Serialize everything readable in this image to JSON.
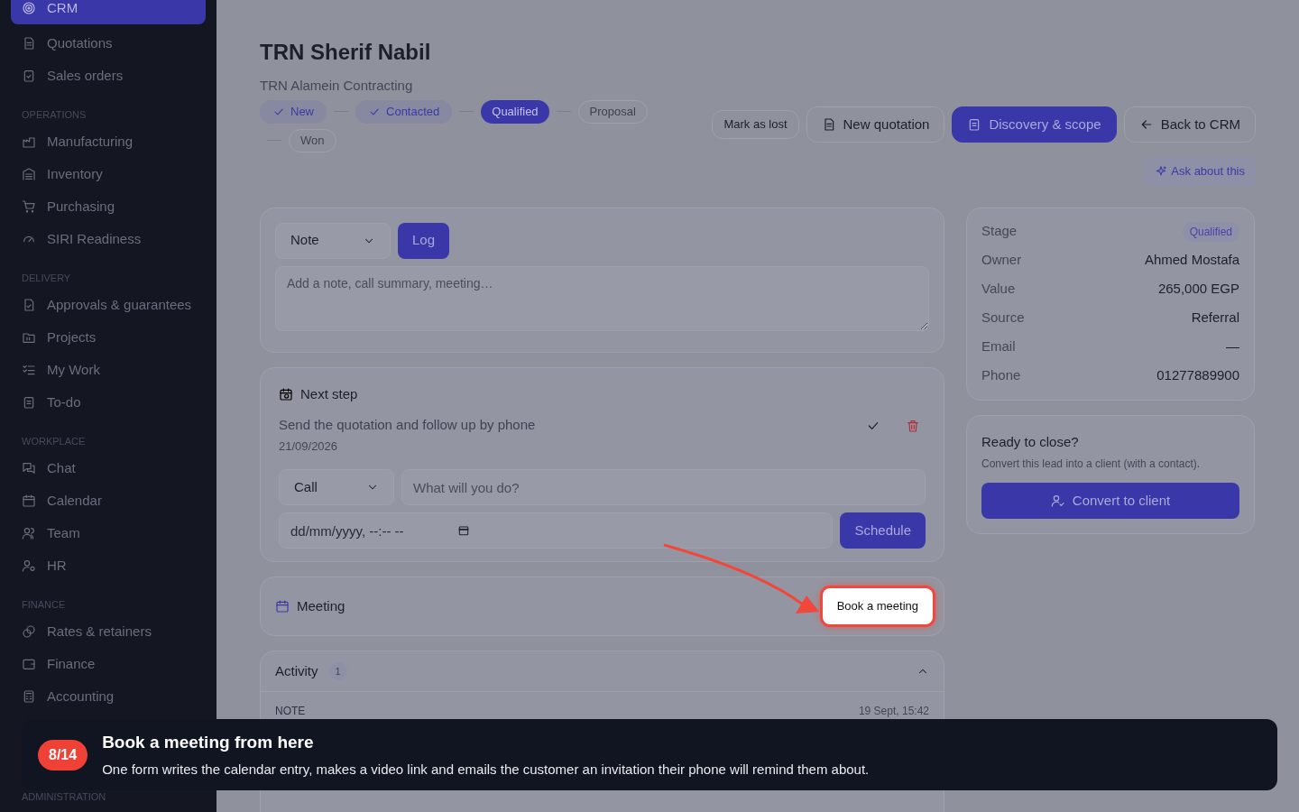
{
  "sidebar": {
    "sections": [
      {
        "items": [
          {
            "label": "CRM",
            "selected": true
          },
          {
            "label": "Quotations",
            "selected": false
          },
          {
            "label": "Sales orders",
            "selected": false
          }
        ]
      },
      {
        "heading": "OPERATIONS",
        "items": [
          {
            "label": "Manufacturing",
            "selected": false
          },
          {
            "label": "Inventory",
            "selected": false
          },
          {
            "label": "Purchasing",
            "selected": false
          },
          {
            "label": "SIRI Readiness",
            "selected": false
          }
        ]
      },
      {
        "heading": "DELIVERY",
        "items": [
          {
            "label": "Approvals & guarantees",
            "selected": false
          },
          {
            "label": "Projects",
            "selected": false
          },
          {
            "label": "My Work",
            "selected": false
          },
          {
            "label": "To-do",
            "selected": false
          }
        ]
      },
      {
        "heading": "WORKPLACE",
        "items": [
          {
            "label": "Chat",
            "selected": false
          },
          {
            "label": "Calendar",
            "selected": false
          },
          {
            "label": "Team",
            "selected": false
          },
          {
            "label": "HR",
            "selected": false
          }
        ]
      },
      {
        "heading": "FINANCE",
        "items": [
          {
            "label": "Rates & retainers",
            "selected": false
          },
          {
            "label": "Finance",
            "selected": false
          },
          {
            "label": "Accounting",
            "selected": false
          }
        ]
      },
      {
        "heading": "ADMINISTRATION"
      }
    ]
  },
  "header": {
    "title": "TRN Sherif Nabil",
    "subtitle": "TRN Alamein Contracting",
    "stages": [
      {
        "label": "New",
        "done": true,
        "selected": false
      },
      {
        "label": "Contacted",
        "done": true,
        "selected": false
      },
      {
        "label": "Qualified",
        "done": false,
        "selected": true
      },
      {
        "label": "Proposal",
        "done": false,
        "selected": false
      },
      {
        "label": "Won",
        "done": false,
        "selected": false
      }
    ],
    "actions": [
      {
        "label": "Mark as lost",
        "kind": "small"
      },
      {
        "label": "New quotation",
        "kind": "document"
      },
      {
        "label": "Discovery & scope",
        "kind": "primary"
      },
      {
        "label": "Back to CRM",
        "kind": "back"
      }
    ],
    "ask": "Ask about this"
  },
  "composer": {
    "type": "Note",
    "button": "Log",
    "placeholder": "Add a note, call summary, meeting…"
  },
  "next_step": {
    "title": "Next step",
    "task": "Send the quotation and follow up by phone",
    "date": "21/09/2026",
    "type": "Call",
    "placeholder": "What will you do?",
    "date_placeholder": "dd/mm/yyyy, --:-- --",
    "button": "Schedule"
  },
  "meeting": {
    "title": "Meeting",
    "button": "Book a meeting",
    "highlighted": true
  },
  "activity": {
    "title": "Activity",
    "count": "1",
    "expanded": true,
    "entries": [
      {
        "type": "NOTE",
        "time": "19 Sept, 15:42"
      }
    ]
  },
  "details": [
    {
      "label": "Stage",
      "value": "Qualified",
      "kind": "badge"
    },
    {
      "label": "Owner",
      "value": "Ahmed Mostafa",
      "kind": "text"
    },
    {
      "label": "Value",
      "value": "265,000 EGP",
      "kind": "text"
    },
    {
      "label": "Source",
      "value": "Referral",
      "kind": "text"
    },
    {
      "label": "Email",
      "value": "—",
      "kind": "text"
    },
    {
      "label": "Phone",
      "value": "01277889900",
      "kind": "text"
    }
  ],
  "close_card": {
    "title": "Ready to close?",
    "text": "Convert this lead into a client (with a contact).",
    "button": "Convert to client"
  },
  "tour": {
    "step": "8/14",
    "title": "Book a meeting from here",
    "text": "One form writes the calendar entry, makes a video link and emails the customer an invitation their phone will remind them about."
  }
}
